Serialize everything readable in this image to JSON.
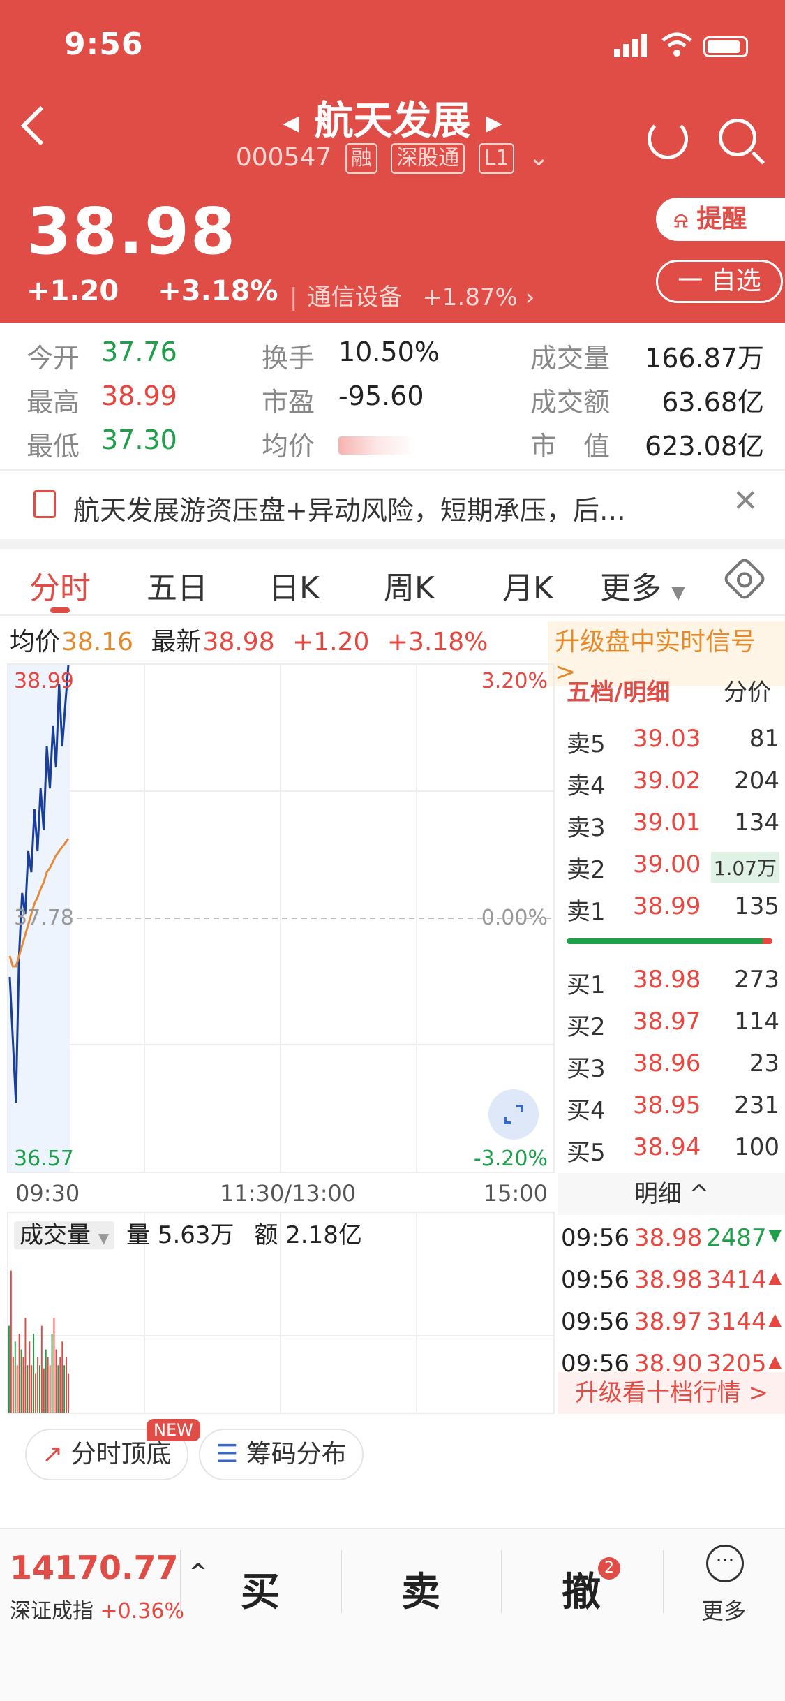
{
  "status_bar": {
    "time": "9:56"
  },
  "header": {
    "title": "航天发展",
    "code": "000547",
    "tags": [
      "融",
      "深股通",
      "L1"
    ],
    "price": "38.98",
    "change": "+1.20",
    "change_pct": "+3.18%",
    "sector_name": "通信设备",
    "sector_change": "+1.87%",
    "remind_label": "提醒",
    "watch_label": "一 自选"
  },
  "stats": {
    "open_label": "今开",
    "open": "37.76",
    "high_label": "最高",
    "high": "38.99",
    "low_label": "最低",
    "low": "37.30",
    "turnover_label": "换手",
    "turnover": "10.50%",
    "pe_label": "市盈",
    "pe": "-95.60",
    "avg_label": "均价",
    "volume_label": "成交量",
    "volume": "166.87万",
    "amount_label": "成交额",
    "amount": "63.68亿",
    "mcap_label": "市　值",
    "mcap": "623.08亿"
  },
  "notice": {
    "text": "航天发展游资压盘+异动风险，短期承压，后…"
  },
  "tabs": [
    "分时",
    "五日",
    "日K",
    "周K",
    "月K",
    "更多"
  ],
  "quote_line": {
    "avg_label": "均价",
    "avg": "38.16",
    "latest_label": "最新",
    "latest": "38.98",
    "change": "+1.20",
    "change_pct": "+3.18%",
    "upgrade": "升级盘中实时信号 >"
  },
  "chart_data": {
    "type": "line",
    "y_high": "38.99",
    "y_mid": "37.78",
    "y_low": "36.57",
    "pct_high": "3.20%",
    "pct_mid": "0.00%",
    "pct_low": "-3.20%",
    "x_labels": [
      "09:30",
      "11:30/13:00",
      "15:00"
    ],
    "series": [
      {
        "values": [
          37.5,
          37.2,
          36.9,
          37.6,
          37.9,
          37.8,
          38.1,
          38.0,
          38.3,
          38.1,
          38.4,
          38.2,
          38.6,
          38.4,
          38.7,
          38.5,
          38.9,
          38.6,
          38.8,
          38.99
        ]
      },
      {
        "values": [
          37.6,
          37.55,
          37.55,
          37.6,
          37.65,
          37.7,
          37.75,
          37.8,
          37.85,
          37.88,
          37.92,
          37.95,
          38.0,
          38.02,
          38.05,
          38.08,
          38.1,
          38.12,
          38.14,
          38.16
        ]
      }
    ],
    "ylim": [
      36.57,
      38.99
    ]
  },
  "volume": {
    "label": "成交量",
    "qty_label": "量",
    "qty": "5.63万",
    "amt_label": "额",
    "amt": "2.18亿",
    "bars": [
      0.55,
      0.9,
      0.35,
      0.45,
      0.3,
      0.5,
      0.4,
      0.35,
      0.6,
      0.3,
      0.45,
      0.3,
      0.5,
      0.25,
      0.35,
      0.3,
      0.55,
      0.28,
      0.4,
      0.35,
      0.3,
      0.5,
      0.6,
      0.4,
      0.3,
      0.35,
      0.45,
      0.3,
      0.35,
      0.25
    ]
  },
  "order_book": {
    "header": "五档/明细",
    "header_right": "分价",
    "asks": [
      {
        "label": "卖5",
        "price": "39.03",
        "vol": "81"
      },
      {
        "label": "卖4",
        "price": "39.02",
        "vol": "204"
      },
      {
        "label": "卖3",
        "price": "39.01",
        "vol": "134"
      },
      {
        "label": "卖2",
        "price": "39.00",
        "vol": "1.07万"
      },
      {
        "label": "卖1",
        "price": "38.99",
        "vol": "135"
      }
    ],
    "bids": [
      {
        "label": "买1",
        "price": "38.98",
        "vol": "273"
      },
      {
        "label": "买2",
        "price": "38.97",
        "vol": "114"
      },
      {
        "label": "买3",
        "price": "38.96",
        "vol": "23"
      },
      {
        "label": "买4",
        "price": "38.95",
        "vol": "231"
      },
      {
        "label": "买5",
        "price": "38.94",
        "vol": "100"
      }
    ],
    "detail_label": "明细 ^",
    "ticks": [
      {
        "time": "09:56",
        "price": "38.98",
        "vol": "2487",
        "dir": "down"
      },
      {
        "time": "09:56",
        "price": "38.98",
        "vol": "3414",
        "dir": "up"
      },
      {
        "time": "09:56",
        "price": "38.97",
        "vol": "3144",
        "dir": "up"
      },
      {
        "time": "09:56",
        "price": "38.90",
        "vol": "3205",
        "dir": "up"
      }
    ],
    "upgrade": "升级看十档行情 >"
  },
  "features": {
    "top_bottom": "分时顶底",
    "new_badge": "NEW",
    "chips": "筹码分布"
  },
  "bottom_bar": {
    "index_value": "14170.77",
    "index_name": "深证成指",
    "index_change": "+0.36%",
    "buy": "买",
    "sell": "卖",
    "cancel": "撤",
    "cancel_badge": "2",
    "more": "更多"
  },
  "colors": {
    "up": "#e8463f",
    "down": "#1e9f4a",
    "brand": "#e04c46"
  }
}
